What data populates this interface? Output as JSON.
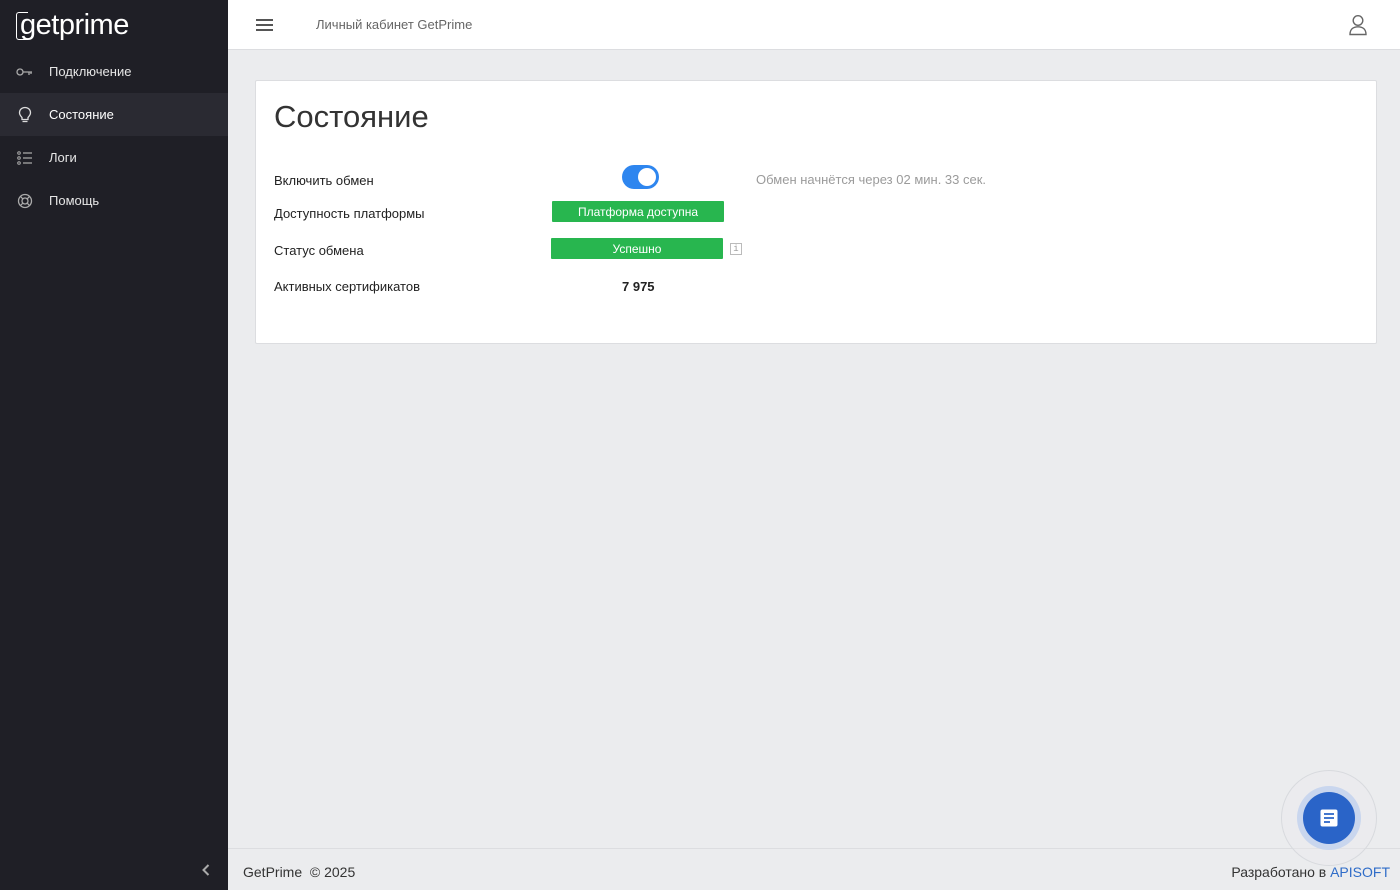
{
  "sidebar": {
    "logo_text": "getprime",
    "items": [
      {
        "label": "Подключение",
        "icon": "key-icon",
        "active": false
      },
      {
        "label": "Состояние",
        "icon": "lightbulb-icon",
        "active": true
      },
      {
        "label": "Логи",
        "icon": "list-icon",
        "active": false
      },
      {
        "label": "Помощь",
        "icon": "lifebuoy-icon",
        "active": false
      }
    ]
  },
  "header": {
    "title": "Личный кабинет GetPrime"
  },
  "card": {
    "title": "Состояние",
    "rows": {
      "exchange_toggle": {
        "label": "Включить обмен",
        "enabled": true,
        "countdown": "Обмен начнётся через 02 мин. 33 сек."
      },
      "platform": {
        "label": "Доступность платформы",
        "badge": "Платформа доступна"
      },
      "exchange_status": {
        "label": "Статус обмена",
        "badge": "Успешно"
      },
      "certificates": {
        "label": "Активных сертификатов",
        "value": "7 975"
      }
    }
  },
  "footer": {
    "left": "GetPrime  © 2025",
    "right_prefix": "Разработано в ",
    "right_link": "APISOFT"
  },
  "colors": {
    "sidebar_bg": "#1f1f26",
    "accent_blue": "#2e86ef",
    "success_green": "#28b64f",
    "link_blue": "#2e6cc8"
  }
}
